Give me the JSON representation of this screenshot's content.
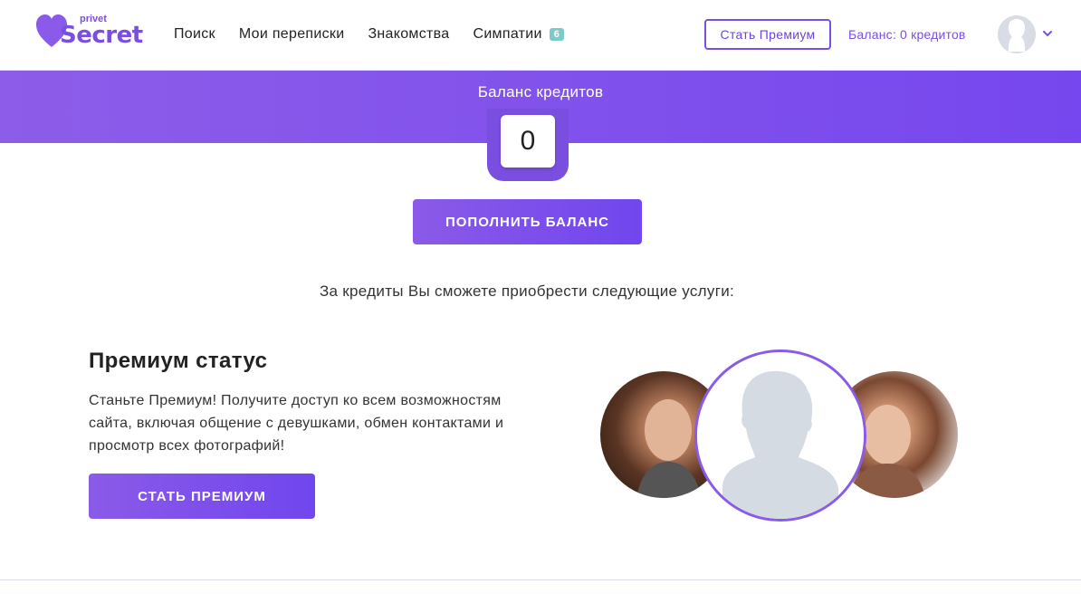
{
  "header": {
    "logo": {
      "small": "privet",
      "big": "Secret"
    },
    "nav": [
      {
        "label": "Поиск"
      },
      {
        "label": "Мои переписки"
      },
      {
        "label": "Знакомства"
      },
      {
        "label": "Симпатии",
        "badge": "6"
      }
    ],
    "premium_button": "Стать Премиум",
    "balance_text": "Баланс: 0 кредитов",
    "avatar_icon": "user-avatar-icon",
    "dropdown_icon": "chevron-down-icon"
  },
  "balance": {
    "title": "Баланс кредитов",
    "value": "0",
    "topup_button": "ПОПОЛНИТЬ БАЛАНС"
  },
  "services": {
    "intro": "За кредиты Вы сможете приобрести следующие услуги:"
  },
  "premium": {
    "title": "Премиум статус",
    "description": "Станьте Премиум! Получите доступ ко всем возможностям сайта, включая общение с девушками, обмен контактами и просмотр всех фотографий!",
    "button": "СТАТЬ ПРЕМИУМ"
  },
  "colors": {
    "accent": "#7a4fe0",
    "badge": "#7ecac8"
  }
}
